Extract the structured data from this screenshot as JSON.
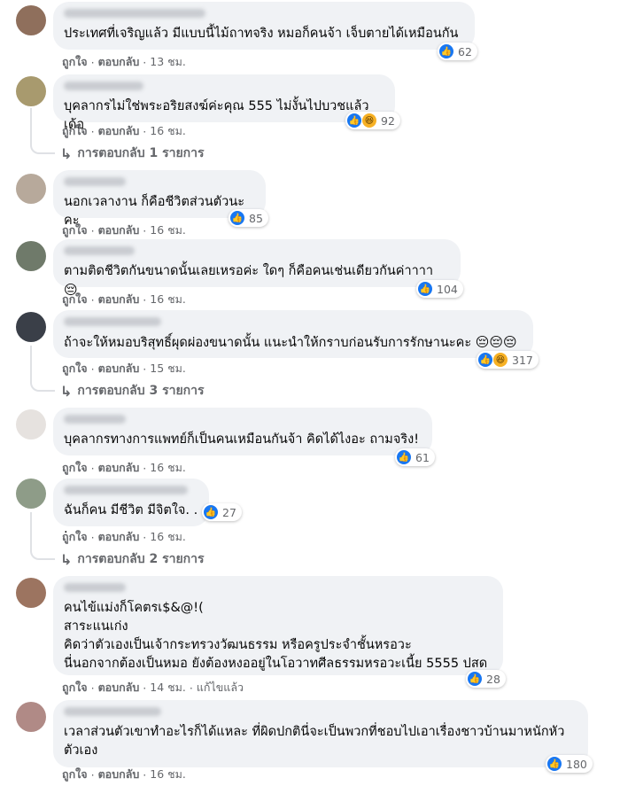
{
  "comments": [
    {
      "text": "ประเทศที่เจริญแล้ว มีแบบนี้ไม้ถาทจริง หมอก็คนจ้า เจ็บตายได้เหมือนกัน",
      "reactions": "62",
      "like": "ถูกใจ",
      "reply": "ตอบกลับ",
      "time": "13 ชม."
    },
    {
      "text": "บุคลากรไม่ใช่พระอริยสงฆ์ค่ะคุณ 555 ไม่งั้นไปบวชแล้วเด้อ",
      "reactions": "92",
      "like": "ถูกใจ",
      "reply": "ตอบกลับ",
      "time": "16 ชม.",
      "replies": "การตอบกลับ 1 รายการ"
    },
    {
      "text": "นอกเวลางาน ก็คือชีวิตส่วนตัวนะคะ",
      "reactions": "85",
      "like": "ถูกใจ",
      "reply": "ตอบกลับ",
      "time": "16 ชม."
    },
    {
      "text": "ตามติดชีวิตกันขนาดนั้นเลยเหรอค่ะ ใดๆ ก็คือคนเช่นเดียวกันค่าาาา",
      "emoji": "😔",
      "reactions": "104",
      "like": "ถูกใจ",
      "reply": "ตอบกลับ",
      "time": "16 ชม."
    },
    {
      "text": "ถ้าจะให้หมอบริสุทธิ์ผุดผ่องขนาดนั้น แนะนำให้กราบก่อนรับการรักษานะคะ",
      "emoji": "😔😔😔",
      "reactions": "317",
      "like": "ถูกใจ",
      "reply": "ตอบกลับ",
      "time": "15 ชม.",
      "replies": "การตอบกลับ 3 รายการ"
    },
    {
      "text": "บุคลากรทางการแพทย์ก็เป็นคนเหมือนกันจ้า คิดได้ไงอะ ถามจริง!",
      "reactions": "61",
      "like": "ถูกใจ",
      "reply": "ตอบกลับ",
      "time": "16 ชม."
    },
    {
      "text": "ฉันก็คน มีชีวิต มีจิตใจ. . .",
      "reactions": "27",
      "like": "ถูกใจ",
      "reply": "ตอบกลับ",
      "time": "16 ชม.",
      "replies": "การตอบกลับ 2 รายการ"
    },
    {
      "text": "คนไข้แม่งก็โคตรเ$&@!(\nสาระแนเก่ง\nคิดว่าตัวเองเป็นเจ้ากระทรวงวัฒนธรรม หรือครูประจำชั้นหรอวะ\nนี่นอกจากต้องเป็นหมอ ยังต้องหงออยู่ในโอวาทศีลธรรมหรอวะเนี้ย 5555 ปสด",
      "reactions": "28",
      "like": "ถูกใจ",
      "reply": "ตอบกลับ",
      "time": "14 ชม.",
      "edited": "แก้ไขแล้ว"
    },
    {
      "text": "เวลาส่วนตัวเขาทำอะไรก็ได้แหละ ที่ผิดปกตินี่จะเป็นพวกที่ชอบไปเอาเรื่องชาวบ้านมาหนักหัว\nตัวเอง",
      "reactions": "180",
      "like": "ถูกใจ",
      "reply": "ตอบกลับ",
      "time": "16 ชม."
    }
  ],
  "dot": "·",
  "colors": {
    "bubble": "#f0f2f5",
    "like_blue": "#1877f2",
    "meta": "#65676b"
  }
}
